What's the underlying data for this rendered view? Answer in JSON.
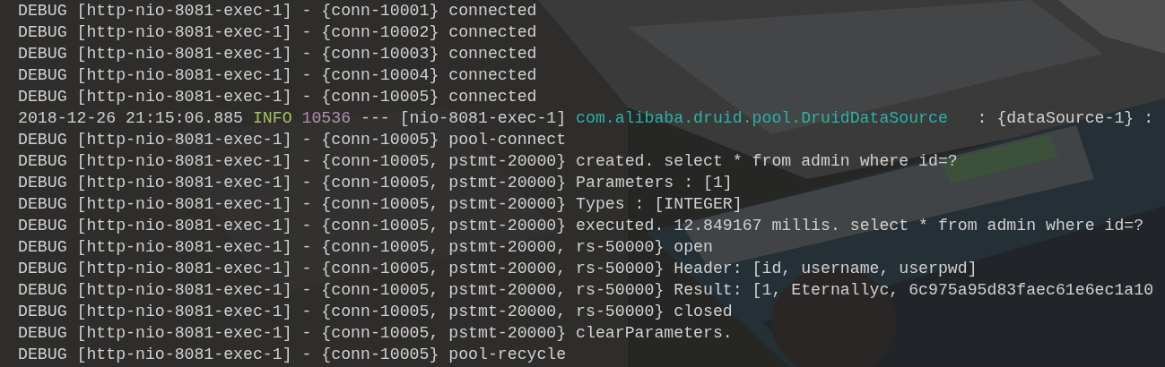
{
  "console": {
    "lines": [
      {
        "segments": [
          {
            "kind": "plain",
            "text": "DEBUG [http-nio-8081-exec-1] - {conn-10001} connected"
          }
        ]
      },
      {
        "segments": [
          {
            "kind": "plain",
            "text": "DEBUG [http-nio-8081-exec-1] - {conn-10002} connected"
          }
        ]
      },
      {
        "segments": [
          {
            "kind": "plain",
            "text": "DEBUG [http-nio-8081-exec-1] - {conn-10003} connected"
          }
        ]
      },
      {
        "segments": [
          {
            "kind": "plain",
            "text": "DEBUG [http-nio-8081-exec-1] - {conn-10004} connected"
          }
        ]
      },
      {
        "segments": [
          {
            "kind": "plain",
            "text": "DEBUG [http-nio-8081-exec-1] - {conn-10005} connected"
          }
        ]
      },
      {
        "segments": [
          {
            "kind": "plain",
            "text": "2018-12-26 21:15:06.885"
          },
          {
            "kind": "level",
            "text": "INFO"
          },
          {
            "kind": "pid",
            "text": "10536"
          },
          {
            "kind": "plain",
            "text": "--- [nio-8081-exec-1]"
          },
          {
            "kind": "logger",
            "text": "com.alibaba.druid.pool.DruidDataSource"
          },
          {
            "kind": "plain",
            "text": "  : {dataSource-1} :"
          }
        ]
      },
      {
        "segments": [
          {
            "kind": "plain",
            "text": "DEBUG [http-nio-8081-exec-1] - {conn-10005} pool-connect"
          }
        ]
      },
      {
        "segments": [
          {
            "kind": "plain",
            "text": "DEBUG [http-nio-8081-exec-1] - {conn-10005, pstmt-20000} created. select * from admin where id=?"
          }
        ]
      },
      {
        "segments": [
          {
            "kind": "plain",
            "text": "DEBUG [http-nio-8081-exec-1] - {conn-10005, pstmt-20000} Parameters : [1]"
          }
        ]
      },
      {
        "segments": [
          {
            "kind": "plain",
            "text": "DEBUG [http-nio-8081-exec-1] - {conn-10005, pstmt-20000} Types : [INTEGER]"
          }
        ]
      },
      {
        "segments": [
          {
            "kind": "plain",
            "text": "DEBUG [http-nio-8081-exec-1] - {conn-10005, pstmt-20000} executed. 12.849167 millis. select * from admin where id=?"
          }
        ]
      },
      {
        "segments": [
          {
            "kind": "plain",
            "text": "DEBUG [http-nio-8081-exec-1] - {conn-10005, pstmt-20000, rs-50000} open"
          }
        ]
      },
      {
        "segments": [
          {
            "kind": "plain",
            "text": "DEBUG [http-nio-8081-exec-1] - {conn-10005, pstmt-20000, rs-50000} Header: [id, username, userpwd]"
          }
        ]
      },
      {
        "segments": [
          {
            "kind": "plain",
            "text": "DEBUG [http-nio-8081-exec-1] - {conn-10005, pstmt-20000, rs-50000} Result: [1, Eternallyc, 6c975a95d83faec61e6ec1a10"
          }
        ]
      },
      {
        "segments": [
          {
            "kind": "plain",
            "text": "DEBUG [http-nio-8081-exec-1] - {conn-10005, pstmt-20000, rs-50000} closed"
          }
        ]
      },
      {
        "segments": [
          {
            "kind": "plain",
            "text": "DEBUG [http-nio-8081-exec-1] - {conn-10005, pstmt-20000} clearParameters."
          }
        ]
      },
      {
        "segments": [
          {
            "kind": "plain",
            "text": "DEBUG [http-nio-8081-exec-1] - {conn-10005} pool-recycle"
          }
        ]
      }
    ]
  }
}
